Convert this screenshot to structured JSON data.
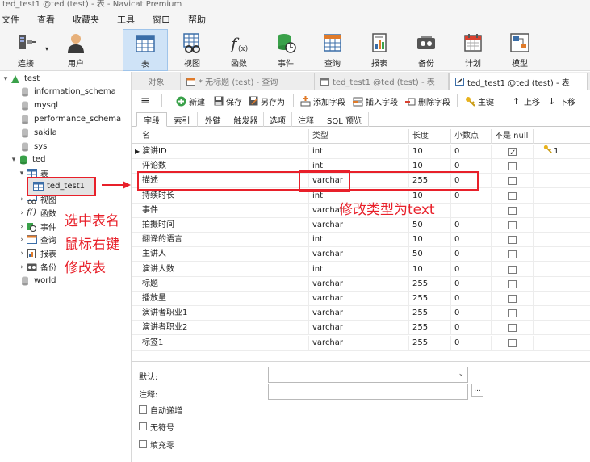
{
  "window": {
    "title": "ted_test1 @ted (test) - 表 - Navicat Premium"
  },
  "menu": [
    "文件",
    "查看",
    "收藏夹",
    "工具",
    "窗口",
    "帮助"
  ],
  "toolbar": {
    "connect": "连接",
    "user": "用户",
    "table": "表",
    "view": "视图",
    "function": "函数",
    "event": "事件",
    "query": "查询",
    "report": "报表",
    "backup": "备份",
    "schedule": "计划",
    "model": "模型"
  },
  "tree": {
    "connection": "test",
    "databases": [
      "information_schema",
      "mysql",
      "performance_schema",
      "sakila",
      "sys"
    ],
    "ted": "ted",
    "tables_group": "表",
    "selected_table": "ted_test1",
    "groups": [
      "视图",
      "函数",
      "事件",
      "查询",
      "报表",
      "备份"
    ],
    "last_db": "world"
  },
  "tabs": [
    "对象",
    "* 无标题 (test) - 查询",
    "ted_test1 @ted (test) - 表",
    "ted_test1 @ted (test) - 表"
  ],
  "editor_toolbar": {
    "new": "新建",
    "save": "保存",
    "save_as": "另存为",
    "add_field": "添加字段",
    "insert_field": "插入字段",
    "delete_field": "删除字段",
    "primary_key": "主键",
    "move_up": "上移",
    "move_down": "下移"
  },
  "subtabs": [
    "字段",
    "索引",
    "外键",
    "触发器",
    "选项",
    "注释",
    "SQL 预览"
  ],
  "grid": {
    "headers": [
      "名",
      "类型",
      "长度",
      "小数点",
      "不是 null"
    ],
    "rows": [
      {
        "name": "演讲ID",
        "type": "int",
        "length": "10",
        "decimals": "0",
        "notnull": true,
        "key": "1"
      },
      {
        "name": "评论数",
        "type": "int",
        "length": "10",
        "decimals": "0",
        "notnull": false,
        "key": ""
      },
      {
        "name": "描述",
        "type": "varchar",
        "length": "255",
        "decimals": "0",
        "notnull": false,
        "key": ""
      },
      {
        "name": "持续时长",
        "type": "int",
        "length": "10",
        "decimals": "0",
        "notnull": false,
        "key": ""
      },
      {
        "name": "事件",
        "type": "varchar",
        "length": "",
        "decimals": "",
        "notnull": false,
        "key": ""
      },
      {
        "name": "拍摄时间",
        "type": "varchar",
        "length": "50",
        "decimals": "0",
        "notnull": false,
        "key": ""
      },
      {
        "name": "翻译的语言",
        "type": "int",
        "length": "10",
        "decimals": "0",
        "notnull": false,
        "key": ""
      },
      {
        "name": "主讲人",
        "type": "varchar",
        "length": "50",
        "decimals": "0",
        "notnull": false,
        "key": ""
      },
      {
        "name": "演讲人数",
        "type": "int",
        "length": "10",
        "decimals": "0",
        "notnull": false,
        "key": ""
      },
      {
        "name": "标题",
        "type": "varchar",
        "length": "255",
        "decimals": "0",
        "notnull": false,
        "key": ""
      },
      {
        "name": "播放量",
        "type": "varchar",
        "length": "255",
        "decimals": "0",
        "notnull": false,
        "key": ""
      },
      {
        "name": "演讲者职业1",
        "type": "varchar",
        "length": "255",
        "decimals": "0",
        "notnull": false,
        "key": ""
      },
      {
        "name": "演讲者职业2",
        "type": "varchar",
        "length": "255",
        "decimals": "0",
        "notnull": false,
        "key": ""
      },
      {
        "name": "标签1",
        "type": "varchar",
        "length": "255",
        "decimals": "0",
        "notnull": false,
        "key": ""
      }
    ]
  },
  "annotations": {
    "left_note_line1": "选中表名",
    "left_note_line2": "鼠标右键",
    "left_note_line3": "修改表",
    "type_note": "修改类型为text",
    "color": "#e8202a"
  },
  "props": {
    "default_label": "默认:",
    "comment_label": "注释:",
    "browse_button": "...",
    "auto_increment": "自动递增",
    "unsigned": "无符号",
    "zerofill": "填充零"
  }
}
